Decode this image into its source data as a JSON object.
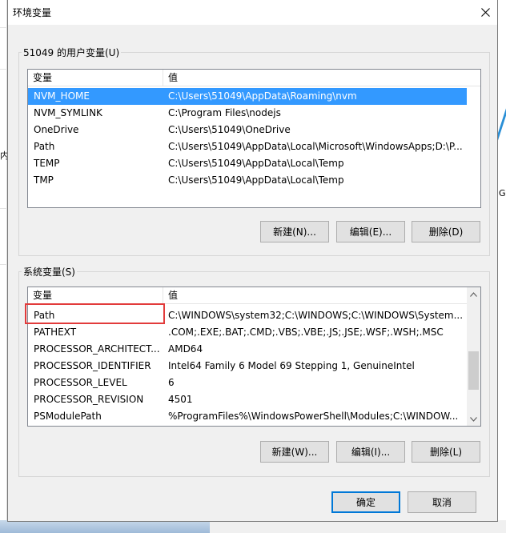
{
  "window": {
    "title": "环境变量"
  },
  "background": {
    "left_fragment": "内",
    "right_fragment": "G"
  },
  "user_vars": {
    "group_label": "51049 的用户变量(U)",
    "columns": [
      "变量",
      "值"
    ],
    "rows": [
      {
        "name": "NVM_HOME",
        "value": "C:\\Users\\51049\\AppData\\Roaming\\nvm",
        "selected": true
      },
      {
        "name": "NVM_SYMLINK",
        "value": "C:\\Program Files\\nodejs"
      },
      {
        "name": "OneDrive",
        "value": "C:\\Users\\51049\\OneDrive"
      },
      {
        "name": "Path",
        "value": "C:\\Users\\51049\\AppData\\Local\\Microsoft\\WindowsApps;D:\\P..."
      },
      {
        "name": "TEMP",
        "value": "C:\\Users\\51049\\AppData\\Local\\Temp"
      },
      {
        "name": "TMP",
        "value": "C:\\Users\\51049\\AppData\\Local\\Temp"
      }
    ],
    "buttons": {
      "new": "新建(N)...",
      "edit": "编辑(E)...",
      "delete": "删除(D)"
    }
  },
  "system_vars": {
    "group_label": "系统变量(S)",
    "columns": [
      "变量",
      "值"
    ],
    "rows": [
      {
        "name": "Path",
        "value": "C:\\WINDOWS\\system32;C:\\WINDOWS;C:\\WINDOWS\\System..."
      },
      {
        "name": "PATHEXT",
        "value": ".COM;.EXE;.BAT;.CMD;.VBS;.VBE;.JS;.JSE;.WSF;.WSH;.MSC"
      },
      {
        "name": "PROCESSOR_ARCHITECT...",
        "value": "AMD64"
      },
      {
        "name": "PROCESSOR_IDENTIFIER",
        "value": "Intel64 Family 6 Model 69 Stepping 1, GenuineIntel"
      },
      {
        "name": "PROCESSOR_LEVEL",
        "value": "6"
      },
      {
        "name": "PROCESSOR_REVISION",
        "value": "4501"
      },
      {
        "name": "PSModulePath",
        "value": "%ProgramFiles%\\WindowsPowerShell\\Modules;C:\\WINDOW..."
      }
    ],
    "buttons": {
      "new": "新建(W)...",
      "edit": "编辑(I)...",
      "delete": "删除(L)"
    }
  },
  "footer": {
    "ok": "确定",
    "cancel": "取消"
  },
  "colors": {
    "selection": "#3399ff",
    "highlight_box": "#e23b3b",
    "default_button_border": "#0078d7"
  }
}
